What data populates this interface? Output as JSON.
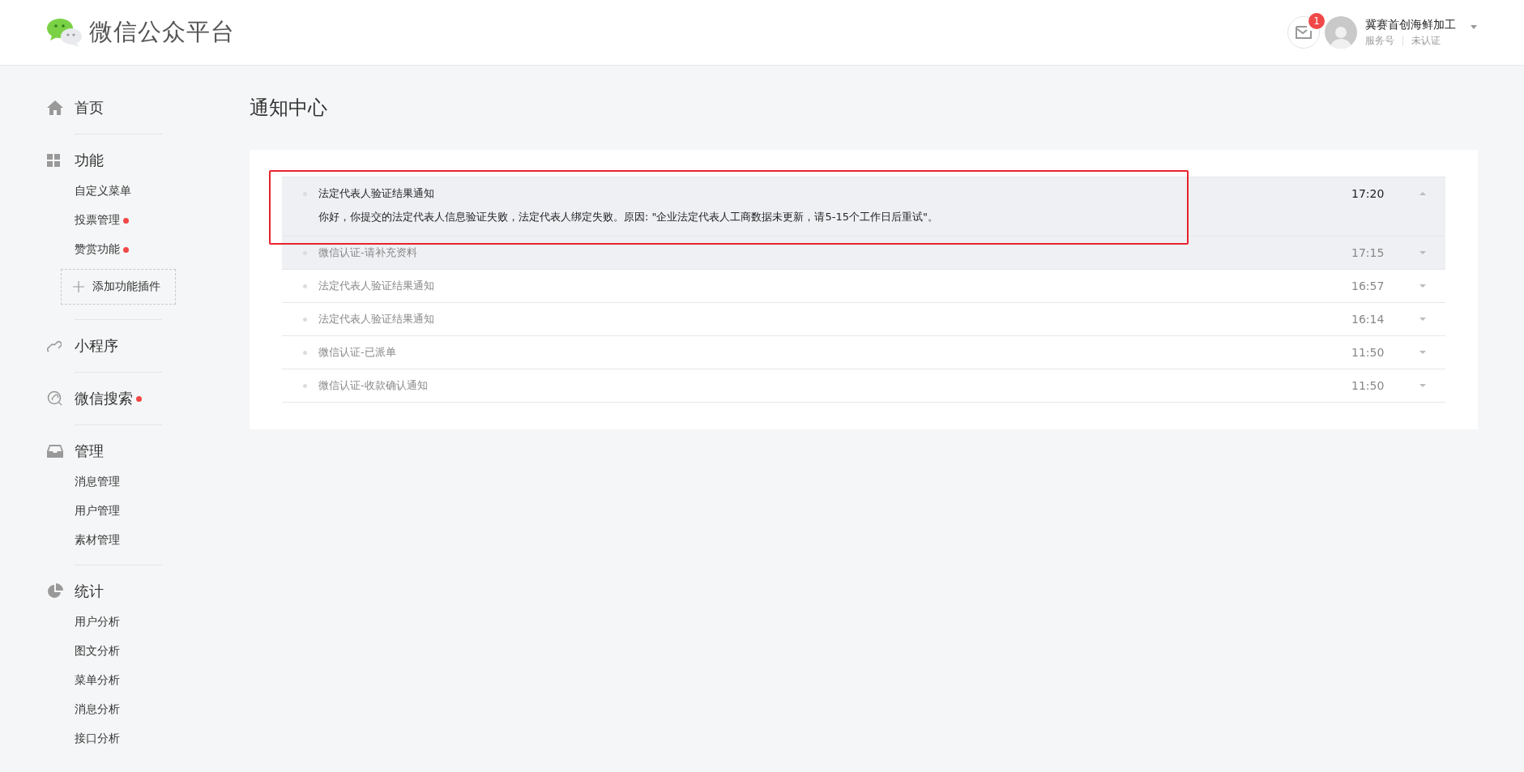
{
  "header": {
    "logo_text": "微信公众平台",
    "mail_badge": "1",
    "account": {
      "name": "冀赛首创海鲜加工",
      "type": "服务号",
      "verification": "未认证"
    }
  },
  "sidebar": {
    "sections": [
      {
        "kind": "home",
        "title": "首页",
        "dot": false
      },
      {
        "kind": "grid",
        "title": "功能",
        "dot": false,
        "items": [
          {
            "label": "自定义菜单",
            "dot": false
          },
          {
            "label": "投票管理",
            "dot": true
          },
          {
            "label": "赞赏功能",
            "dot": true
          }
        ],
        "add_button": "添加功能插件"
      },
      {
        "kind": "link",
        "title": "小程序",
        "dot": false
      },
      {
        "kind": "search",
        "title": "微信搜索",
        "dot": true
      },
      {
        "kind": "inbox",
        "title": "管理",
        "dot": false,
        "items": [
          {
            "label": "消息管理",
            "dot": false
          },
          {
            "label": "用户管理",
            "dot": false
          },
          {
            "label": "素材管理",
            "dot": false
          }
        ]
      },
      {
        "kind": "pie",
        "title": "统计",
        "dot": false,
        "items": [
          {
            "label": "用户分析",
            "dot": false
          },
          {
            "label": "图文分析",
            "dot": false
          },
          {
            "label": "菜单分析",
            "dot": false
          },
          {
            "label": "消息分析",
            "dot": false
          },
          {
            "label": "接口分析",
            "dot": false
          }
        ]
      }
    ]
  },
  "page_title": "通知中心",
  "notifications": [
    {
      "title": "法定代表人验证结果通知",
      "time": "17:20",
      "expanded": true,
      "hovered": true,
      "annotated": true,
      "body": "你好，你提交的法定代表人信息验证失败，法定代表人绑定失败。原因: \"企业法定代表人工商数据未更新，请5-15个工作日后重试\"。"
    },
    {
      "title": "微信认证-请补充资料",
      "time": "17:15",
      "expanded": false,
      "hovered": true,
      "annotated": false
    },
    {
      "title": "法定代表人验证结果通知",
      "time": "16:57",
      "expanded": false,
      "hovered": false,
      "annotated": false
    },
    {
      "title": "法定代表人验证结果通知",
      "time": "16:14",
      "expanded": false,
      "hovered": false,
      "annotated": false
    },
    {
      "title": "微信认证-已派单",
      "time": "11:50",
      "expanded": false,
      "hovered": false,
      "annotated": false
    },
    {
      "title": "微信认证-收款确认通知",
      "time": "11:50",
      "expanded": false,
      "hovered": false,
      "annotated": false
    }
  ]
}
